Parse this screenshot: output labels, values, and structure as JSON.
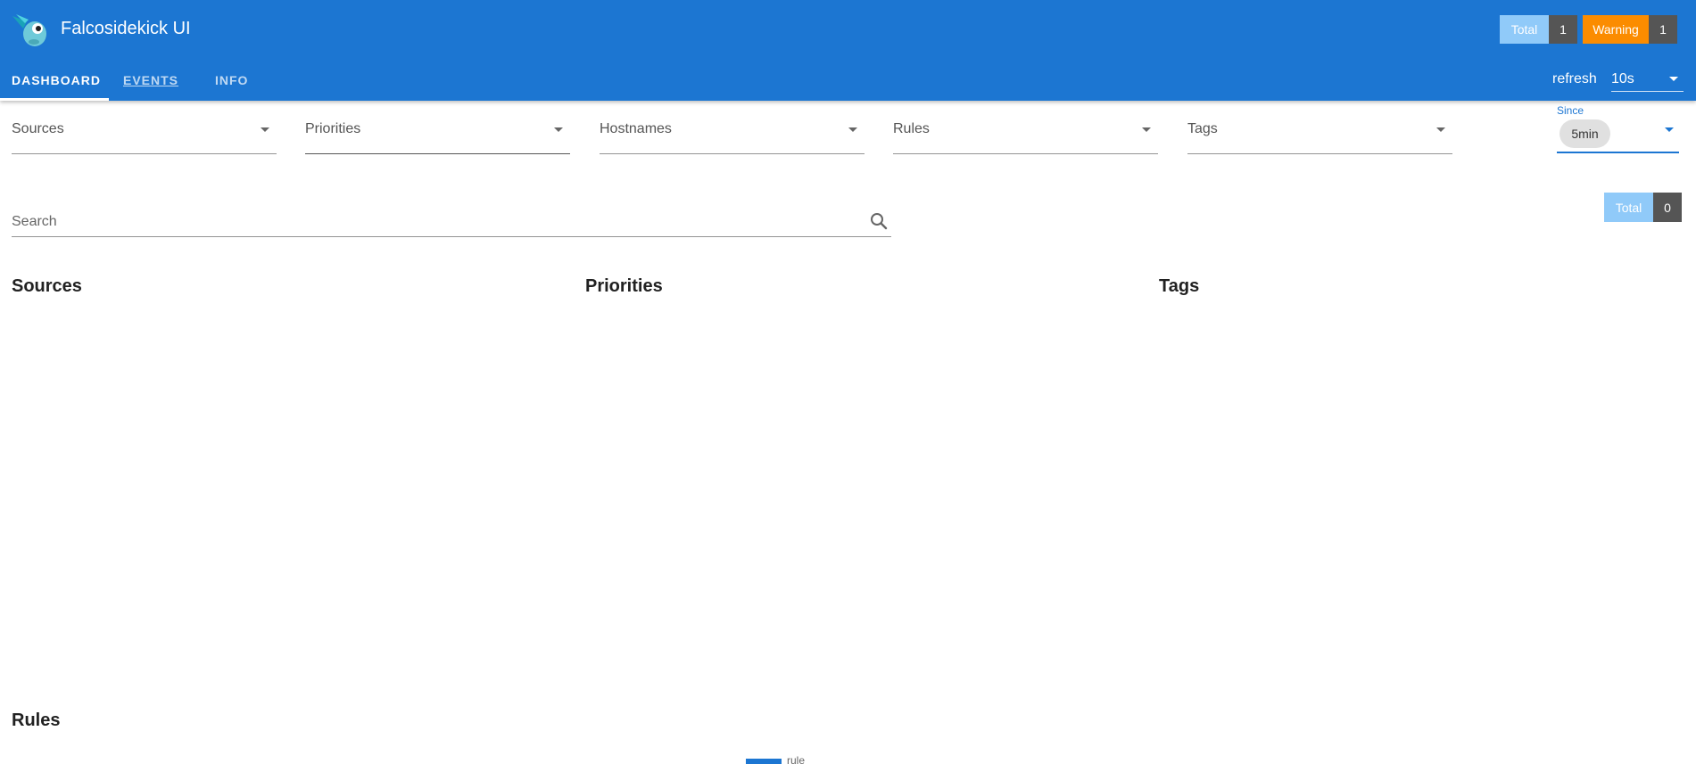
{
  "app": {
    "title": "Falcosidekick UI"
  },
  "header_badges": {
    "total": {
      "label": "Total",
      "count": "1"
    },
    "warning": {
      "label": "Warning",
      "count": "1"
    }
  },
  "tabs": [
    {
      "label": "DASHBOARD"
    },
    {
      "label": "EVENTS"
    },
    {
      "label": "INFO"
    }
  ],
  "refresh": {
    "label": "refresh",
    "value": "10s"
  },
  "filters": {
    "sources": "Sources",
    "priorities": "Priorities",
    "hostnames": "Hostnames",
    "rules": "Rules",
    "tags": "Tags"
  },
  "since": {
    "label": "Since",
    "value": "5min"
  },
  "search": {
    "placeholder": "Search"
  },
  "results_badge": {
    "label": "Total",
    "count": "0"
  },
  "sections": {
    "sources": "Sources",
    "priorities": "Priorities",
    "tags": "Tags",
    "rules": "Rules"
  },
  "rules_legend": {
    "label": "rule",
    "color": "#1c76d2"
  },
  "colors": {
    "primary": "#1c76d2",
    "warning": "#fb8c00",
    "total": "#90caf9"
  }
}
